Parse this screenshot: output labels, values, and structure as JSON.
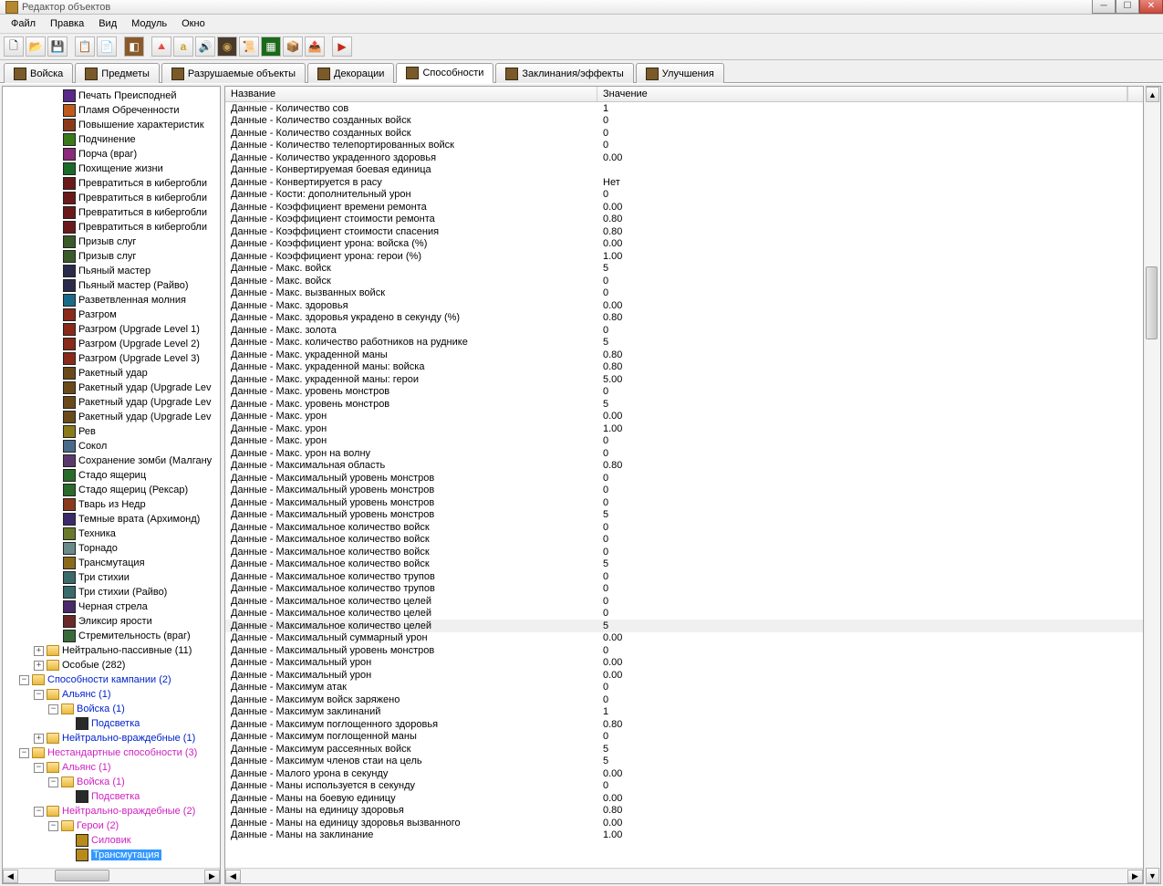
{
  "window": {
    "title": "Редактор объектов"
  },
  "menu": [
    "Файл",
    "Правка",
    "Вид",
    "Модуль",
    "Окно"
  ],
  "tabs": [
    {
      "label": "Войска"
    },
    {
      "label": "Предметы"
    },
    {
      "label": "Разрушаемые объекты"
    },
    {
      "label": "Декорации"
    },
    {
      "label": "Способности",
      "active": true
    },
    {
      "label": "Заклинания/эффекты"
    },
    {
      "label": "Улучшения"
    }
  ],
  "tree_items": [
    {
      "label": "Печать Преисподней",
      "color": "#5a2a8a"
    },
    {
      "label": "Пламя Обреченности",
      "color": "#c05a1a"
    },
    {
      "label": "Повышение характеристик",
      "color": "#8a3a1a"
    },
    {
      "label": "Подчинение",
      "color": "#3a7a1a"
    },
    {
      "label": "Порча (враг)",
      "color": "#8a2a7a"
    },
    {
      "label": "Похищение жизни",
      "color": "#1a6a2a"
    },
    {
      "label": "Превратиться в кибергобли",
      "color": "#6a1a1a"
    },
    {
      "label": "Превратиться в кибергобли",
      "color": "#6a1a1a"
    },
    {
      "label": "Превратиться в кибергобли",
      "color": "#6a1a1a"
    },
    {
      "label": "Превратиться в кибергобли",
      "color": "#6a1a1a"
    },
    {
      "label": "Призыв слуг",
      "color": "#3a5a2a"
    },
    {
      "label": "Призыв слуг",
      "color": "#3a5a2a"
    },
    {
      "label": "Пьяный мастер",
      "color": "#2a2a4a"
    },
    {
      "label": "Пьяный мастер (Райво)",
      "color": "#2a2a4a"
    },
    {
      "label": "Разветвленная молния",
      "color": "#1a6a8a"
    },
    {
      "label": "Разгром",
      "color": "#8a2a1a"
    },
    {
      "label": "Разгром (Upgrade Level 1)",
      "color": "#8a2a1a"
    },
    {
      "label": "Разгром (Upgrade Level 2)",
      "color": "#8a2a1a"
    },
    {
      "label": "Разгром (Upgrade Level 3)",
      "color": "#8a2a1a"
    },
    {
      "label": "Ракетный удар",
      "color": "#6a4a1a"
    },
    {
      "label": "Ракетный удар (Upgrade Lev",
      "color": "#6a4a1a"
    },
    {
      "label": "Ракетный удар (Upgrade Lev",
      "color": "#6a4a1a"
    },
    {
      "label": "Ракетный удар (Upgrade Lev",
      "color": "#6a4a1a"
    },
    {
      "label": "Рев",
      "color": "#8a7a1a"
    },
    {
      "label": "Сокол",
      "color": "#4a6a8a"
    },
    {
      "label": "Сохранение зомби (Малгану",
      "color": "#5a3a6a"
    },
    {
      "label": "Стадо ящериц",
      "color": "#2a6a2a"
    },
    {
      "label": "Стадо ящериц (Рексар)",
      "color": "#2a6a2a"
    },
    {
      "label": "Тварь из Недр",
      "color": "#8a3a1a"
    },
    {
      "label": "Темные врата (Архимонд)",
      "color": "#3a2a6a"
    },
    {
      "label": "Техника",
      "color": "#6a7a2a"
    },
    {
      "label": "Торнадо",
      "color": "#6a8a8a"
    },
    {
      "label": "Трансмутация",
      "color": "#8a6a1a"
    },
    {
      "label": "Три стихии",
      "color": "#3a6a6a"
    },
    {
      "label": "Три стихии (Райво)",
      "color": "#3a6a6a"
    },
    {
      "label": "Черная стрела",
      "color": "#4a2a6a"
    },
    {
      "label": "Эликсир ярости",
      "color": "#6a2a2a"
    },
    {
      "label": "Стремительность (враг)",
      "color": "#3a6a3a"
    }
  ],
  "tree_nodes": [
    {
      "depth": 0,
      "exp": "⊞",
      "folder": true,
      "label": "Нейтрально-пассивные (11)",
      "cls": ""
    },
    {
      "depth": 0,
      "exp": "⊞",
      "folder": true,
      "label": "Особые (282)",
      "cls": ""
    },
    {
      "depth": -1,
      "exp": "⊟",
      "folder": true,
      "label": "Способности кампании (2)",
      "cls": "blue"
    },
    {
      "depth": 0,
      "exp": "⊟",
      "folder": true,
      "label": "Альянс (1)",
      "cls": "blue"
    },
    {
      "depth": 1,
      "exp": "⊟",
      "folder": true,
      "label": "Войска (1)",
      "cls": "blue"
    },
    {
      "depth": 2,
      "exp": " ",
      "folder": false,
      "color": "#2a2a2a",
      "label": "Подсветка",
      "cls": "blue"
    },
    {
      "depth": 0,
      "exp": "⊞",
      "folder": true,
      "label": "Нейтрально-враждебные (1)",
      "cls": "blue"
    },
    {
      "depth": -1,
      "exp": "⊟",
      "folder": true,
      "label": "Нестандартные способности (3)",
      "cls": "pink"
    },
    {
      "depth": 0,
      "exp": "⊟",
      "folder": true,
      "label": "Альянс (1)",
      "cls": "pink"
    },
    {
      "depth": 1,
      "exp": "⊟",
      "folder": true,
      "label": "Войска (1)",
      "cls": "pink"
    },
    {
      "depth": 2,
      "exp": " ",
      "folder": false,
      "color": "#2a2a2a",
      "label": "Подсветка",
      "cls": "pink"
    },
    {
      "depth": 0,
      "exp": "⊟",
      "folder": true,
      "label": "Нейтрально-враждебные (2)",
      "cls": "pink"
    },
    {
      "depth": 1,
      "exp": "⊟",
      "folder": true,
      "label": "Герои (2)",
      "cls": "pink"
    },
    {
      "depth": 2,
      "exp": " ",
      "folder": false,
      "color": "#b88a1a",
      "label": "Силовик",
      "cls": "pink"
    },
    {
      "depth": 2,
      "exp": " ",
      "folder": false,
      "color": "#b88a1a",
      "label": "Трансмутация",
      "cls": "pink",
      "selected": true
    }
  ],
  "table": {
    "headers": {
      "name": "Название",
      "value": "Значение"
    },
    "rows": [
      {
        "name": "Данные - Количество сов",
        "value": "1"
      },
      {
        "name": "Данные - Количество созданных войск",
        "value": "0"
      },
      {
        "name": "Данные - Количество созданных войск",
        "value": "0"
      },
      {
        "name": "Данные - Количество телепортированных войск",
        "value": "0"
      },
      {
        "name": "Данные - Количество украденного здоровья",
        "value": "0.00"
      },
      {
        "name": "Данные - Конвертируемая боевая единица",
        "value": ""
      },
      {
        "name": "Данные - Конвертируется в расу",
        "value": "Нет"
      },
      {
        "name": "Данные - Кости: дополнительный урон",
        "value": "0"
      },
      {
        "name": "Данные - Коэффициент времени ремонта",
        "value": "0.00"
      },
      {
        "name": "Данные - Коэффициент стоимости ремонта",
        "value": "0.80"
      },
      {
        "name": "Данные - Коэффициент стоимости спасения",
        "value": "0.80"
      },
      {
        "name": "Данные - Коэффициент урона: войска (%)",
        "value": "0.00"
      },
      {
        "name": "Данные - Коэффициент урона: герои (%)",
        "value": "1.00"
      },
      {
        "name": "Данные - Макс. войск",
        "value": "5"
      },
      {
        "name": "Данные - Макс. войск",
        "value": "0"
      },
      {
        "name": "Данные - Макс. вызванных войск",
        "value": "0"
      },
      {
        "name": "Данные - Макс. здоровья",
        "value": "0.00"
      },
      {
        "name": "Данные - Макс. здоровья украдено в секунду (%)",
        "value": "0.80"
      },
      {
        "name": "Данные - Макс. золота",
        "value": "0"
      },
      {
        "name": "Данные - Макс. количество работников на руднике",
        "value": "5"
      },
      {
        "name": "Данные - Макс. украденной маны",
        "value": "0.80"
      },
      {
        "name": "Данные - Макс. украденной маны: войска",
        "value": "0.80"
      },
      {
        "name": "Данные - Макс. украденной маны: герои",
        "value": "5.00"
      },
      {
        "name": "Данные - Макс. уровень монстров",
        "value": "0"
      },
      {
        "name": "Данные - Макс. уровень монстров",
        "value": "5"
      },
      {
        "name": "Данные - Макс. урон",
        "value": "0.00"
      },
      {
        "name": "Данные - Макс. урон",
        "value": "1.00"
      },
      {
        "name": "Данные - Макс. урон",
        "value": "0"
      },
      {
        "name": "Данные - Макс. урон на волну",
        "value": "0"
      },
      {
        "name": "Данные - Максимальная область",
        "value": "0.80"
      },
      {
        "name": "Данные - Максимальный уровень монстров",
        "value": "0"
      },
      {
        "name": "Данные - Максимальный уровень монстров",
        "value": "0"
      },
      {
        "name": "Данные - Максимальный уровень монстров",
        "value": "0"
      },
      {
        "name": "Данные - Максимальный уровень монстров",
        "value": "5"
      },
      {
        "name": "Данные - Максимальное количество войск",
        "value": "0"
      },
      {
        "name": "Данные - Максимальное количество войск",
        "value": "0"
      },
      {
        "name": "Данные - Максимальное количество войск",
        "value": "0"
      },
      {
        "name": "Данные - Максимальное количество войск",
        "value": "5"
      },
      {
        "name": "Данные - Максимальное количество трупов",
        "value": "0"
      },
      {
        "name": "Данные - Максимальное количество трупов",
        "value": "0"
      },
      {
        "name": "Данные - Максимальное количество целей",
        "value": "0"
      },
      {
        "name": "Данные - Максимальное количество целей",
        "value": "0"
      },
      {
        "name": "Данные - Максимальное количество целей",
        "value": "5",
        "sel": true
      },
      {
        "name": "Данные - Максимальный суммарный урон",
        "value": "0.00"
      },
      {
        "name": "Данные - Максимальный уровень монстров",
        "value": "0"
      },
      {
        "name": "Данные - Максимальный урон",
        "value": "0.00"
      },
      {
        "name": "Данные - Максимальный урон",
        "value": "0.00"
      },
      {
        "name": "Данные - Максимум атак",
        "value": "0"
      },
      {
        "name": "Данные - Максимум войск заряжено",
        "value": "0"
      },
      {
        "name": "Данные - Максимум заклинаний",
        "value": "1"
      },
      {
        "name": "Данные - Максимум поглощенного здоровья",
        "value": "0.80"
      },
      {
        "name": "Данные - Максимум поглощенной маны",
        "value": "0"
      },
      {
        "name": "Данные - Максимум рассеянных войск",
        "value": "5"
      },
      {
        "name": "Данные - Максимум членов стаи на цель",
        "value": "5"
      },
      {
        "name": "Данные - Малого урона в секунду",
        "value": "0.00"
      },
      {
        "name": "Данные - Маны используется в секунду",
        "value": "0"
      },
      {
        "name": "Данные - Маны на боевую единицу",
        "value": "0.00"
      },
      {
        "name": "Данные - Маны на единицу здоровья",
        "value": "0.80"
      },
      {
        "name": "Данные - Маны на единицу здоровья вызванного",
        "value": "0.00"
      },
      {
        "name": "Данные - Маны на заклинание",
        "value": "1.00"
      }
    ]
  }
}
